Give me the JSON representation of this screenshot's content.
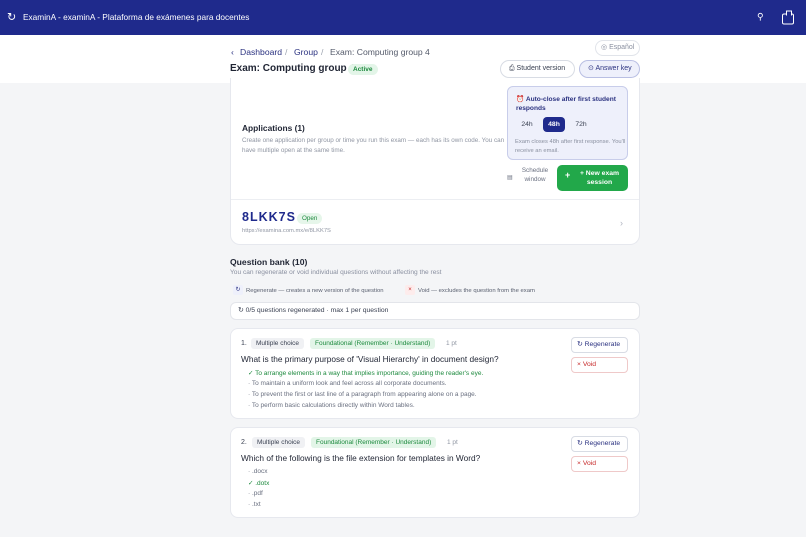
{
  "window": {
    "title": "ExaminA - examinA - Plataforma de exámenes para docentes"
  },
  "breadcrumb": {
    "dashboard": "Dashboard",
    "group": "Group",
    "current": "Exam: Computing group 4"
  },
  "header": {
    "language": "Español",
    "title": "Exam: Computing group 4",
    "status": "Active",
    "student_version": "Student version",
    "answer_key": "Answer key"
  },
  "applications": {
    "title": "Applications (1)",
    "description": "Create one application per group or time you run this exam — each has its own code. You can have multiple open at the same time.",
    "auto_close": {
      "title": "Auto-close after first student responds",
      "options": [
        "24h",
        "48h",
        "72h"
      ],
      "selected": "48h",
      "note": "Exam closes 48h after first response. You'll receive an email."
    },
    "schedule_label": "Schedule window",
    "new_session_label": "+ New exam session",
    "session": {
      "code": "8LKK7S",
      "status": "Open",
      "url": "https://examina.com.mx/e/8LKK7S"
    }
  },
  "question_bank": {
    "title": "Question bank (10)",
    "description": "You can regenerate or void individual questions without affecting the rest",
    "legend_regen": "Regenerate — creates a new version of the question",
    "legend_void": "Void — excludes the question from the exam",
    "regen_counter": "0/5 questions regenerated · max 1 per question",
    "regen_button": "Regenerate",
    "void_button": "Void",
    "questions": [
      {
        "number": "1.",
        "type": "Multiple choice",
        "level": "Foundational (Remember · Understand)",
        "points": "1 pt",
        "text": "What is the primary purpose of 'Visual Hierarchy' in document design?",
        "options": [
          {
            "text": "✓ To arrange elements in a way that implies importance, guiding the reader's eye.",
            "correct": true
          },
          {
            "text": "· To maintain a uniform look and feel across all corporate documents.",
            "correct": false
          },
          {
            "text": "· To prevent the first or last line of a paragraph from appearing alone on a page.",
            "correct": false
          },
          {
            "text": "· To perform basic calculations directly within Word tables.",
            "correct": false
          }
        ]
      },
      {
        "number": "2.",
        "type": "Multiple choice",
        "level": "Foundational (Remember · Understand)",
        "points": "1 pt",
        "text": "Which of the following is the file extension for templates in Word?",
        "options": [
          {
            "text": "· .docx",
            "correct": false
          },
          {
            "text": "✓ .dotx",
            "correct": true
          },
          {
            "text": "· .pdf",
            "correct": false
          },
          {
            "text": "· .txt",
            "correct": false
          }
        ]
      }
    ]
  },
  "colors": {
    "brand": "#1f2a8c",
    "success": "#22a84a",
    "danger": "#c62828"
  }
}
